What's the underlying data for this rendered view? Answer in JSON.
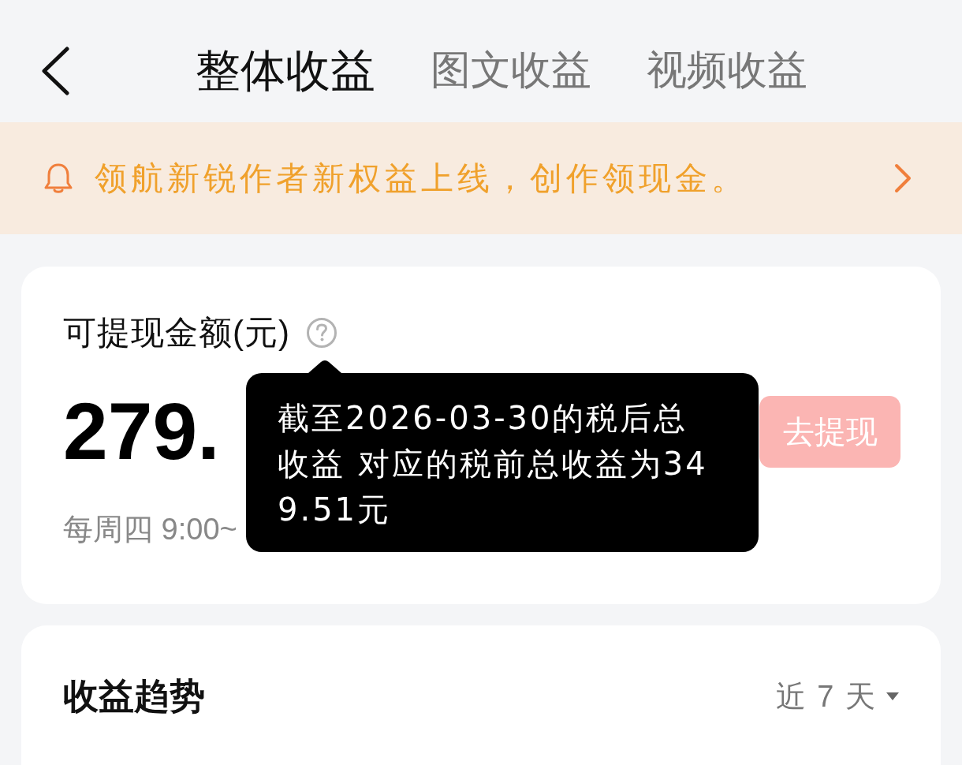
{
  "nav": {
    "tabs": [
      {
        "label": "整体收益",
        "selected": true
      },
      {
        "label": "图文收益",
        "selected": false
      },
      {
        "label": "视频收益",
        "selected": false
      }
    ]
  },
  "banner": {
    "text": "领航新锐作者新权益上线，创作领现金。"
  },
  "balance_card": {
    "label": "可提现金额(元)",
    "amount": "279.",
    "withdraw_button": {
      "label": "去提现",
      "disabled": true
    },
    "schedule": "每周四 9:00~"
  },
  "tooltip": {
    "text": "截至2026-03-30的税后总收益 对应的税前总收益为349.51元"
  },
  "trend_card": {
    "title": "收益趋势",
    "range": "近 7 天"
  }
}
